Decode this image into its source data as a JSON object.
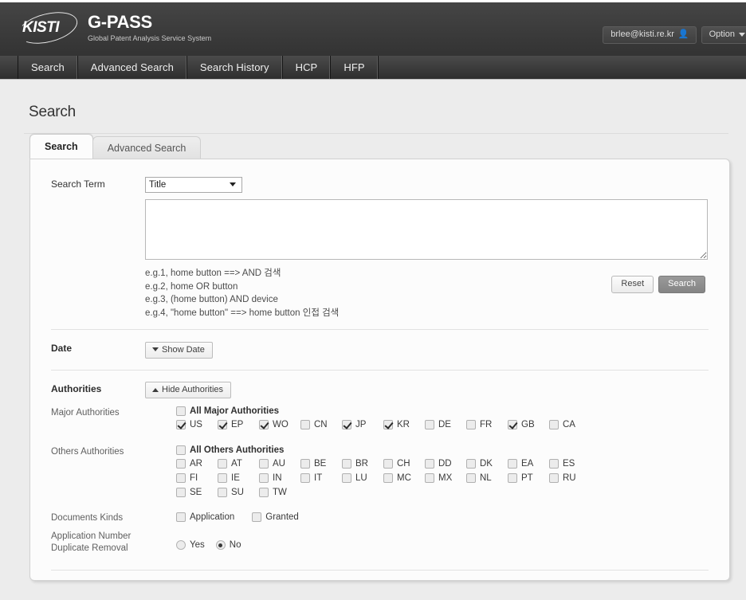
{
  "header": {
    "logo_mark": "KISTI",
    "product": "G-PASS",
    "subtitle": "Global Patent Analysis Service System",
    "user_email": "brlee@kisti.re.kr",
    "user_icon": "user-icon",
    "option_label": "Option",
    "option_icon": "chevron-down-icon"
  },
  "nav": {
    "items": [
      {
        "label": "Search"
      },
      {
        "label": "Advanced Search"
      },
      {
        "label": "Search History"
      },
      {
        "label": "HCP"
      },
      {
        "label": "HFP"
      }
    ]
  },
  "page": {
    "title": "Search"
  },
  "tabs": [
    {
      "label": "Search",
      "active": true
    },
    {
      "label": "Advanced Search",
      "active": false
    }
  ],
  "form": {
    "search_term": {
      "label": "Search Term",
      "selected_option": "Title",
      "options": [
        "Title"
      ],
      "textarea_value": "",
      "textarea_placeholder": ""
    },
    "examples": [
      "e.g.1, home button ==> AND 검색",
      "e.g.2, home OR button",
      "e.g.3, (home button) AND device",
      "e.g.4, \"home button\" ==> home button 인접 검색"
    ],
    "buttons": {
      "reset": "Reset",
      "search": "Search"
    },
    "date": {
      "label": "Date",
      "toggle_label": "Show Date",
      "toggle_icon": "triangle-down-icon"
    },
    "authorities": {
      "label": "Authorities",
      "toggle_label": "Hide Authorities",
      "toggle_icon": "triangle-up-icon",
      "major": {
        "label": "Major Authorities",
        "all_label": "All Major Authorities",
        "all_checked": false,
        "items": [
          {
            "code": "US",
            "checked": true
          },
          {
            "code": "EP",
            "checked": true
          },
          {
            "code": "WO",
            "checked": true
          },
          {
            "code": "CN",
            "checked": false
          },
          {
            "code": "JP",
            "checked": true
          },
          {
            "code": "KR",
            "checked": true
          },
          {
            "code": "DE",
            "checked": false
          },
          {
            "code": "FR",
            "checked": false
          },
          {
            "code": "GB",
            "checked": true
          },
          {
            "code": "CA",
            "checked": false
          }
        ]
      },
      "others": {
        "label": "Others Authorities",
        "all_label": "All Others Authorities",
        "all_checked": false,
        "items": [
          {
            "code": "AR",
            "checked": false
          },
          {
            "code": "AT",
            "checked": false
          },
          {
            "code": "AU",
            "checked": false
          },
          {
            "code": "BE",
            "checked": false
          },
          {
            "code": "BR",
            "checked": false
          },
          {
            "code": "CH",
            "checked": false
          },
          {
            "code": "DD",
            "checked": false
          },
          {
            "code": "DK",
            "checked": false
          },
          {
            "code": "EA",
            "checked": false
          },
          {
            "code": "ES",
            "checked": false
          },
          {
            "code": "FI",
            "checked": false
          },
          {
            "code": "IE",
            "checked": false
          },
          {
            "code": "IN",
            "checked": false
          },
          {
            "code": "IT",
            "checked": false
          },
          {
            "code": "LU",
            "checked": false
          },
          {
            "code": "MC",
            "checked": false
          },
          {
            "code": "MX",
            "checked": false
          },
          {
            "code": "NL",
            "checked": false
          },
          {
            "code": "PT",
            "checked": false
          },
          {
            "code": "RU",
            "checked": false
          },
          {
            "code": "SE",
            "checked": false
          },
          {
            "code": "SU",
            "checked": false
          },
          {
            "code": "TW",
            "checked": false
          }
        ]
      }
    },
    "documents_kinds": {
      "label": "Documents Kinds",
      "items": [
        {
          "label": "Application",
          "checked": false
        },
        {
          "label": "Granted",
          "checked": false
        }
      ]
    },
    "duplicate_removal": {
      "label_line1": "Application Number",
      "label_line2": "Duplicate Removal",
      "options": [
        {
          "label": "Yes",
          "selected": false
        },
        {
          "label": "No",
          "selected": true
        }
      ]
    }
  }
}
